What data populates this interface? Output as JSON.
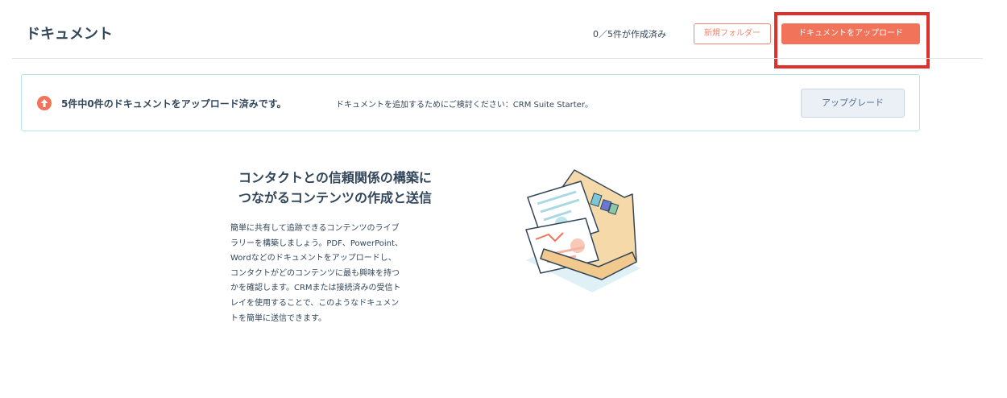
{
  "header": {
    "title": "ドキュメント",
    "count_text": "0／5件が作成済み",
    "new_folder_label": "新規フォルダー",
    "upload_label": "ドキュメントをアップロード"
  },
  "banner": {
    "icon": "arrow-up-circle-icon",
    "bold_text": "5件中0件のドキュメントをアップロード済みです。",
    "text": "ドキュメントを追加するためにご検討ください：CRM Suite Starter。",
    "upgrade_label": "アップグレード"
  },
  "empty_state": {
    "heading_line1": "コンタクトとの信頼関係の構築に",
    "heading_line2": "つながるコンテンツの作成と送信",
    "body_lines": [
      "簡単に共有して追跡できるコンテンツのライブ",
      "ラリーを構築しましょう。PDF、PowerPoint、",
      "Wordなどのドキュメントをアップロードし、",
      "コンタクトがどのコンテンツに最も興味を持つ",
      "かを確認します。CRMまたは接続済みの受信ト",
      "レイを使用することで、このようなドキュメン",
      "トを簡単に送信できます。"
    ],
    "illustration": "document-folder-illustration"
  },
  "colors": {
    "accent": "#f0735a",
    "highlight": "#e0302b",
    "banner_border": "#b6e2ec",
    "text": "#33475b"
  }
}
